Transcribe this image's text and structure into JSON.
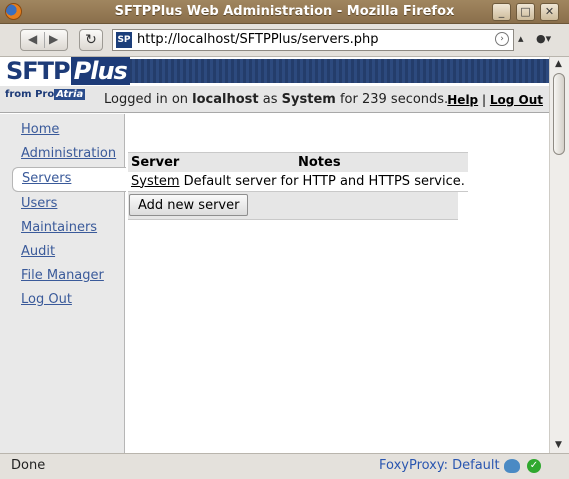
{
  "window": {
    "title": "SFTPPlus Web Administration - Mozilla Firefox",
    "buttons": {
      "minimize": "_",
      "maximize": "□",
      "close": "✕"
    }
  },
  "navbar": {
    "url": "http://localhost/SFTPPlus/servers.php",
    "site_icon_text": "SP"
  },
  "header": {
    "logo_text": "SFTP",
    "logo_plus": "Plus",
    "logo_from": "from",
    "logo_brand_a": "Pro",
    "logo_brand_b": "Atria",
    "login": {
      "prefix": "Logged in on",
      "host": "localhost",
      "as": "as",
      "user": "System",
      "for": "for 239 seconds."
    },
    "help_link": "Help",
    "separator": "|",
    "logout_link": "Log Out"
  },
  "sidebar": {
    "items": [
      {
        "label": "Home"
      },
      {
        "label": "Administration"
      },
      {
        "label": "Servers"
      },
      {
        "label": "Users"
      },
      {
        "label": "Maintainers"
      },
      {
        "label": "Audit"
      },
      {
        "label": "File Manager"
      },
      {
        "label": "Log Out"
      }
    ],
    "active_index": 2
  },
  "servers_table": {
    "headers": [
      "Server",
      "Notes"
    ],
    "rows": [
      {
        "server": "System",
        "notes": "Default server for HTTP and HTTPS service."
      }
    ],
    "add_button": "Add new server"
  },
  "statusbar": {
    "status": "Done",
    "proxy_label": "FoxyProxy: Default",
    "ok_glyph": "✓"
  },
  "colors": {
    "titlebar": "#9a7f58",
    "link_blue": "#3a5a9a",
    "logo_blue": "#1d3b78",
    "foxyproxy_blue": "#2a56b0"
  }
}
